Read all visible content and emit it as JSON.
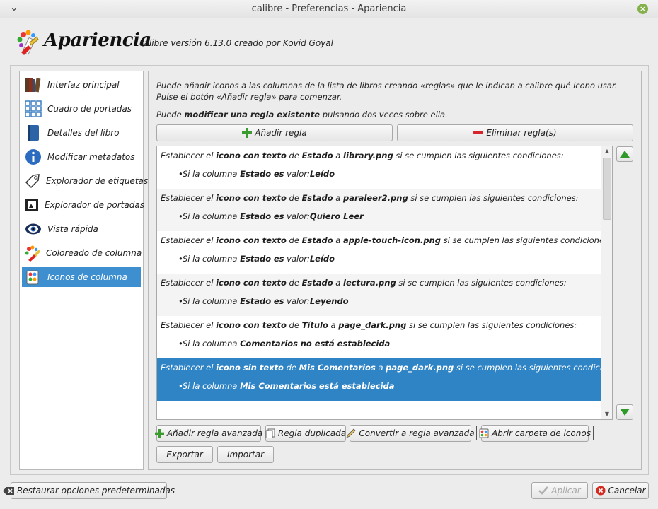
{
  "window": {
    "title": "calibre - Preferencias - Apariencia"
  },
  "header": {
    "title": "Apariencia",
    "subtitle": "calibre versión 6.13.0 creado por Kovid Goyal"
  },
  "sidebar": {
    "items": [
      {
        "label": "Interfaz principal",
        "icon": "books-icon"
      },
      {
        "label": "Cuadro de portadas",
        "icon": "grid-icon"
      },
      {
        "label": "Detalles del libro",
        "icon": "book-icon"
      },
      {
        "label": "Modificar metadatos",
        "icon": "info-icon"
      },
      {
        "label": "Explorador de etiquetas",
        "icon": "tag-icon"
      },
      {
        "label": "Explorador de portadas",
        "icon": "cover-icon"
      },
      {
        "label": "Vista rápida",
        "icon": "eye-icon"
      },
      {
        "label": "Coloreado de columna",
        "icon": "palette-icon"
      },
      {
        "label": "Iconos de columna",
        "icon": "icons-icon",
        "selected": true
      }
    ]
  },
  "main": {
    "description": "Puede añadir iconos a las columnas de la lista de libros creando «reglas» que le indican a calibre qué icono usar. Pulse el botón «Añadir regla» para comenzar.",
    "hint_pre": "Puede ",
    "hint_bold": "modificar una regla existente",
    "hint_post": " pulsando dos veces sobre ella.",
    "add_rule": "Añadir regla",
    "remove_rule": "Eliminar regla(s)",
    "rules": [
      {
        "kind": "icono con texto",
        "column": "Estado",
        "file": "library.png",
        "cond_col": "Estado",
        "cond_op": "es",
        "cond_mid": " valor:",
        "cond_val": "Leído"
      },
      {
        "kind": "icono con texto",
        "column": "Estado",
        "file": "paraleer2.png",
        "cond_col": "Estado",
        "cond_op": "es",
        "cond_mid": " valor:",
        "cond_val": "Quiero Leer"
      },
      {
        "kind": "icono con texto",
        "column": "Estado",
        "file": "apple-touch-icon.png",
        "cond_col": "Estado",
        "cond_op": "es",
        "cond_mid": " valor:",
        "cond_val": "Leído"
      },
      {
        "kind": "icono con texto",
        "column": "Estado",
        "file": "lectura.png",
        "cond_col": "Estado",
        "cond_op": "es",
        "cond_mid": " valor:",
        "cond_val": "Leyendo"
      },
      {
        "kind": "icono con texto",
        "column": "Título",
        "file": "page_dark.png",
        "cond_col": "Comentarios",
        "cond_op": "no está establecida",
        "cond_mid": "",
        "cond_val": ""
      },
      {
        "kind": "icono sin texto",
        "column": "Mis Comentarios",
        "file": "page_dark.png",
        "cond_col": "Mis Comentarios",
        "cond_op": "está establecida",
        "cond_mid": "",
        "cond_val": "",
        "selected": true
      }
    ],
    "text": {
      "establish": "Establecer el ",
      "of": " de ",
      "to": " a ",
      "if": " si se cumplen las siguientes condiciones:",
      "cond_prefix": "Si la columna "
    },
    "buttons": {
      "advanced": "Añadir regla avanzada",
      "duplicate": "Regla duplicada",
      "convert": "Convertir a regla avanzada",
      "open_folder": "Abrir carpeta de iconos",
      "export": "Exportar",
      "import": "Importar"
    }
  },
  "footer": {
    "restore": "Restaurar opciones predeterminadas",
    "apply": "Aplicar",
    "cancel": "Cancelar"
  }
}
